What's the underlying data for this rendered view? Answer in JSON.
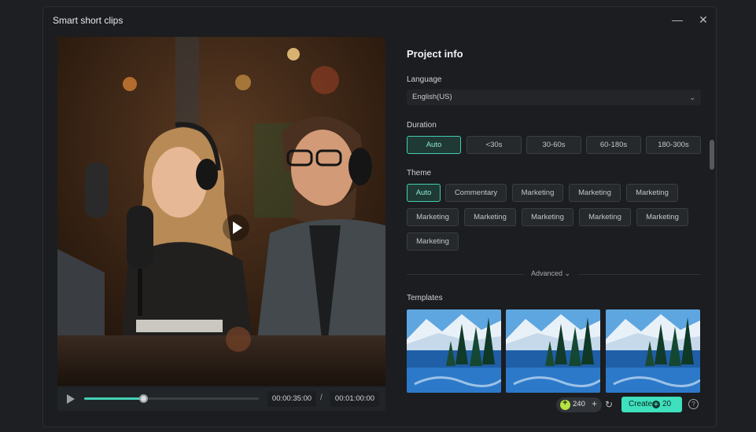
{
  "window": {
    "title": "Smart short clips",
    "minimize_icon": "minimize-icon",
    "close_icon": "close-icon"
  },
  "player": {
    "current_time": "00:00:35:00",
    "separator": "/",
    "total_time": "00:01:00:00",
    "progress": 0.34,
    "play_icon": "play-icon"
  },
  "project": {
    "title": "Project info",
    "language_label": "Language",
    "language_value": "English(US)",
    "duration_label": "Duration",
    "duration_options": [
      "Auto",
      "<30s",
      "30-60s",
      "60-180s",
      "180-300s"
    ],
    "duration_selected": "Auto",
    "theme_label": "Theme",
    "theme_options": [
      "Auto",
      "Commentary",
      "Marketing",
      "Marketing",
      "Marketing",
      "Marketing",
      "Marketing",
      "Marketing",
      "Marketing",
      "Marketing",
      "Marketing"
    ],
    "theme_selected": "Auto",
    "advanced_label": "Advanced",
    "templates_label": "Templates"
  },
  "footer": {
    "credits": "240",
    "create_label": "Create",
    "create_cost": "20",
    "help_icon": "help-icon",
    "refresh_icon": "refresh-icon"
  },
  "colors": {
    "accent": "#3ee0bd",
    "background": "#1b1d20"
  }
}
